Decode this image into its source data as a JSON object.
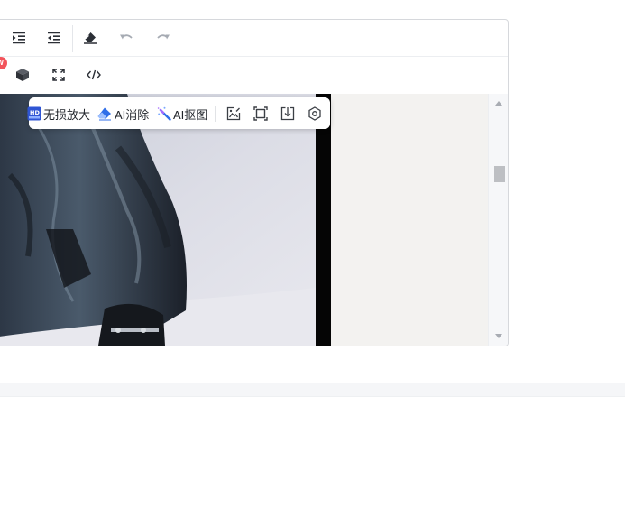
{
  "image_toolbar": {
    "upscale_label": "无损放大",
    "ai_erase_label": "AI消除",
    "ai_cutout_label": "AI抠图"
  },
  "toolbar": {
    "new_badge": "EW"
  },
  "icons": {
    "indent": "indent-icon",
    "outdent": "outdent-icon",
    "eraser": "eraser-icon",
    "undo": "undo-icon",
    "redo": "redo-icon",
    "cube": "cube-icon",
    "fullscreen": "fullscreen-icon",
    "code": "code-icon"
  },
  "colors": {
    "badge": "#f2545b",
    "photo_bg": "#dfe0e8"
  }
}
